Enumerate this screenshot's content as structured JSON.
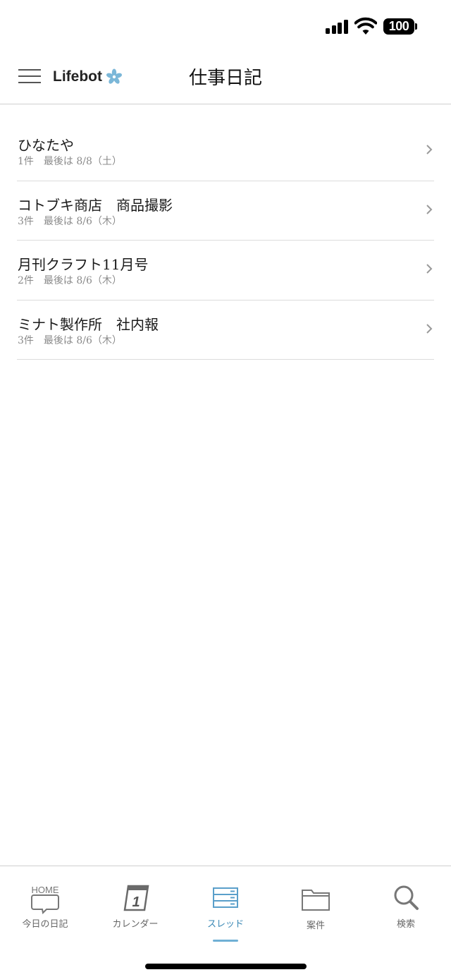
{
  "status_bar": {
    "battery": "100",
    "icons": [
      "cellular-signal-icon",
      "wifi-icon",
      "battery-icon"
    ]
  },
  "header": {
    "brand": "Lifebot",
    "brand_icon": "flower-icon",
    "title": "仕事日記",
    "menu_icon": "hamburger-menu-icon",
    "accent_color": "#6fb0d5"
  },
  "threads": [
    {
      "title": "ひなたや",
      "meta": "1件　最後は 8/8（土）"
    },
    {
      "title": "コトブキ商店　商品撮影",
      "meta": "3件　最後は 8/6（木）"
    },
    {
      "title": "月刊クラフト11月号",
      "meta": "2件　最後は 8/6（木）"
    },
    {
      "title": "ミナト製作所　社内報",
      "meta": "3件　最後は 8/6（木）"
    }
  ],
  "tab_bar": {
    "active_color": "#3a88b5",
    "tabs": [
      {
        "label": "今日の日記",
        "icon": "home-speech-bubble-icon",
        "icon_text": "HOME"
      },
      {
        "label": "カレンダー",
        "icon": "calendar-icon",
        "icon_text": "1"
      },
      {
        "label": "スレッド",
        "icon": "thread-stack-icon",
        "active": true
      },
      {
        "label": "案件",
        "icon": "folder-icon"
      },
      {
        "label": "検索",
        "icon": "search-icon"
      }
    ]
  }
}
